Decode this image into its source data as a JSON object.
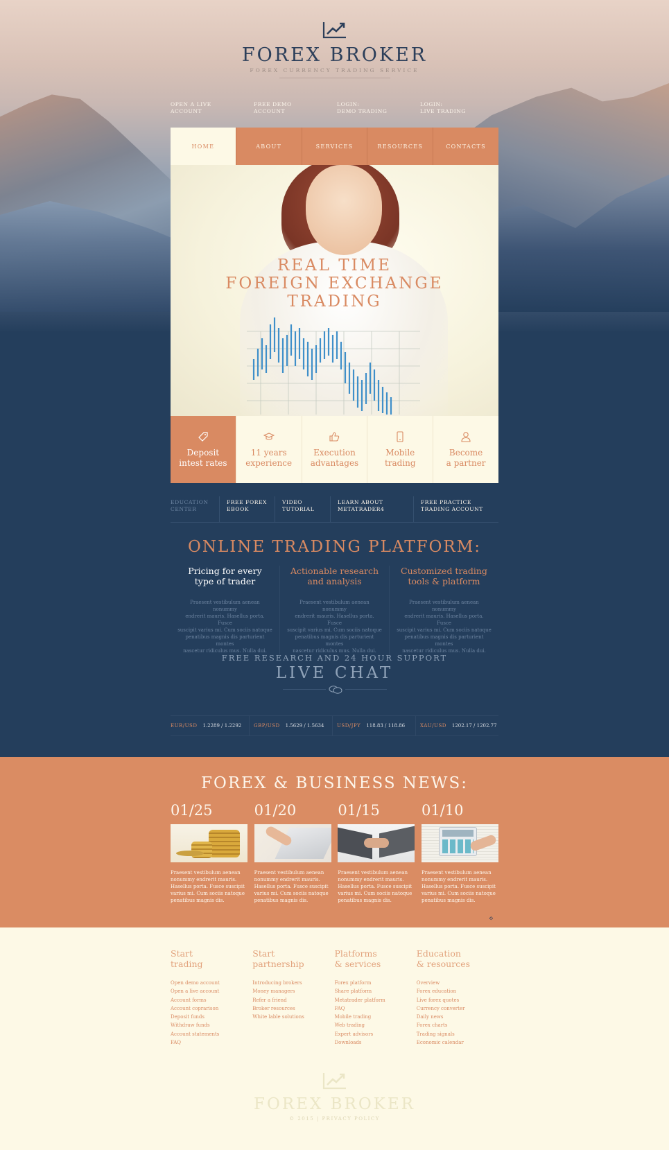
{
  "brand": {
    "name": "FOREX BROKER",
    "tagline": "FOREX CURRENCY TRADING SERVICE",
    "icon": "chart-up-icon",
    "accent": "#d98a62",
    "navy": "#243e5c"
  },
  "top_links": [
    {
      "line1": "OPEN A LIVE",
      "line2": "ACCOUNT"
    },
    {
      "line1": "FREE DEMO",
      "line2": "ACCOUNT"
    },
    {
      "line1": "LOGIN:",
      "line2": "DEMO TRADING"
    },
    {
      "line1": "LOGIN:",
      "line2": "LIVE TRADING"
    }
  ],
  "nav": [
    "HOME",
    "ABOUT",
    "SERVICES",
    "RESOURCES",
    "CONTACTS"
  ],
  "hero": {
    "line1": "REAL TIME",
    "line2": "FOREIGN EXCHANGE",
    "line3": "TRADING"
  },
  "features": [
    {
      "icon": "tag-icon",
      "line1": "Deposit",
      "line2": "intest rates"
    },
    {
      "icon": "graduation-cap-icon",
      "line1": "11 years",
      "line2": "experience"
    },
    {
      "icon": "thumbs-up-icon",
      "line1": "Execution",
      "line2": "advantages"
    },
    {
      "icon": "mobile-icon",
      "line1": "Mobile",
      "line2": "trading"
    },
    {
      "icon": "user-icon",
      "line1": "Become",
      "line2": "a partner"
    }
  ],
  "education": [
    {
      "line1": "EDUCATION",
      "line2": "CENTER"
    },
    {
      "line1": "FREE FOREX",
      "line2": "EBOOK"
    },
    {
      "line1": "VIDEO",
      "line2": "TUTORIAL"
    },
    {
      "line1": "LEARN ABOUT",
      "line2": "METATRADER4"
    },
    {
      "line1": "FREE PRACTICE",
      "line2": "TRADING ACCOUNT"
    }
  ],
  "platform": {
    "title": "ONLINE TRADING PLATFORM:",
    "columns": [
      {
        "line1": "Pricing for every",
        "line2": "type of trader",
        "text": [
          "Praesent vestibulum aenean nonummy",
          "endrerit mauris. Hasellus porta. Fusce",
          "suscipit varius mi. Cum sociis natoque",
          "penatibus magnis dis parturient montes",
          "nascetur ridiculus mus. Nulla dui."
        ]
      },
      {
        "line1": "Actionable research",
        "line2": "and analysis",
        "text": [
          "Praesent vestibulum aenean nonummy",
          "endrerit mauris. Hasellus porta. Fusce",
          "suscipit varius mi. Cum sociis natoque",
          "penatibus magnis dis parturient montes",
          "nascetur ridiculus mus. Nulla dui."
        ]
      },
      {
        "line1": "Customized trading",
        "line2": "tools & platform",
        "text": [
          "Praesent vestibulum aenean nonummy",
          "endrerit mauris. Hasellus porta. Fusce",
          "suscipit varius mi. Cum sociis natoque",
          "penatibus magnis dis parturient montes",
          "nascetur ridiculus mus. Nulla dui."
        ]
      }
    ]
  },
  "support": {
    "subtitle": "FREE RESEARCH AND 24 HOUR SUPPORT",
    "title": "LIVE CHAT"
  },
  "ticker": [
    {
      "pair": "EUR/USD",
      "value": "1.2289 / 1.2292"
    },
    {
      "pair": "GBP/USD",
      "value": "1.5629 / 1.5634"
    },
    {
      "pair": "USD/JPY",
      "value": "118.83 / 118.86"
    },
    {
      "pair": "XAU/USD",
      "value": "1202.17 / 1202.77"
    }
  ],
  "news": {
    "title": "FOREX & BUSINESS NEWS:",
    "items": [
      {
        "date": "01/25",
        "image": "gold-coins",
        "text": [
          "Praesent vestibulum aenean",
          "nonummy endrerit mauris.",
          "Hasellus porta. Fusce suscipit",
          "varius mi. Cum sociis natoque",
          "penatibus magnis dis."
        ]
      },
      {
        "date": "01/20",
        "image": "laptop-typing",
        "text": [
          "Praesent vestibulum aenean",
          "nonummy endrerit mauris.",
          "Hasellus porta. Fusce suscipit",
          "varius mi. Cum sociis natoque",
          "penatibus magnis dis."
        ]
      },
      {
        "date": "01/15",
        "image": "handshake",
        "text": [
          "Praesent vestibulum aenean",
          "nonummy endrerit mauris.",
          "Hasellus porta. Fusce suscipit",
          "varius mi. Cum sociis natoque",
          "penatibus magnis dis."
        ]
      },
      {
        "date": "01/10",
        "image": "calculator",
        "text": [
          "Praesent vestibulum aenean",
          "nonummy endrerit mauris.",
          "Hasellus porta. Fusce suscipit",
          "varius mi. Cum sociis natoque",
          "penatibus magnis dis."
        ]
      }
    ],
    "arrows": "‹›"
  },
  "footer": {
    "columns": [
      {
        "line1": "Start",
        "line2": "trading",
        "links": [
          "Open demo account",
          "Open a live account",
          "Account forms",
          "Account coprarison",
          "Deposit funds",
          "Withdraw funds",
          "Account statements",
          "FAQ"
        ]
      },
      {
        "line1": "Start",
        "line2": "partnership",
        "links": [
          "Introducing brokers",
          "Money managers",
          "Refer a friend",
          "Broker resources",
          "White lable solutions"
        ]
      },
      {
        "line1": "Platforms",
        "line2": "& services",
        "links": [
          "Forex platform",
          "Share platform",
          "Metatrader platform",
          "FAQ",
          "Mobile trading",
          "Web trading",
          "Expert advisors",
          "Downloads"
        ]
      },
      {
        "line1": "Education",
        "line2": "& resources",
        "links": [
          "Overview",
          "Forex education",
          "Live forex quotes",
          "Currency converter",
          "Daily news",
          "Forex charts",
          "Trading signals",
          "Economic calendar"
        ]
      }
    ],
    "brand": "FOREX BROKER",
    "copyright": "© 2015 | PRIVACY POLICY"
  }
}
